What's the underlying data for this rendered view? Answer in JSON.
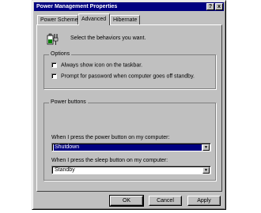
{
  "window": {
    "title": "Power Management Properties"
  },
  "titlebar": {
    "help_label": "?",
    "close_label": "x"
  },
  "tabs": [
    {
      "label": "Power Schemes"
    },
    {
      "label": "Advanced"
    },
    {
      "label": "Hibernate"
    }
  ],
  "advanced": {
    "intro_text": "Select the behaviors you want.",
    "options": {
      "title": "Options",
      "checkboxes": [
        {
          "label": "Always show icon on the taskbar.",
          "checked": false
        },
        {
          "label": "Prompt for password when computer goes off standby.",
          "checked": false
        }
      ]
    },
    "power_buttons": {
      "title": "Power buttons",
      "power_label": "When I press the power button on my computer:",
      "power_value": "Shutdown",
      "sleep_label": "When I press the sleep button on my computer:",
      "sleep_value": "Standby"
    }
  },
  "buttons": {
    "ok": "OK",
    "cancel": "Cancel",
    "apply": "Apply"
  },
  "dropdown_arrow": "▼",
  "colors": {
    "titlebar": "#000080",
    "face": "#c0c0c0",
    "selection": "#000080"
  },
  "icons": {
    "intro": "battery-plug-icon"
  }
}
